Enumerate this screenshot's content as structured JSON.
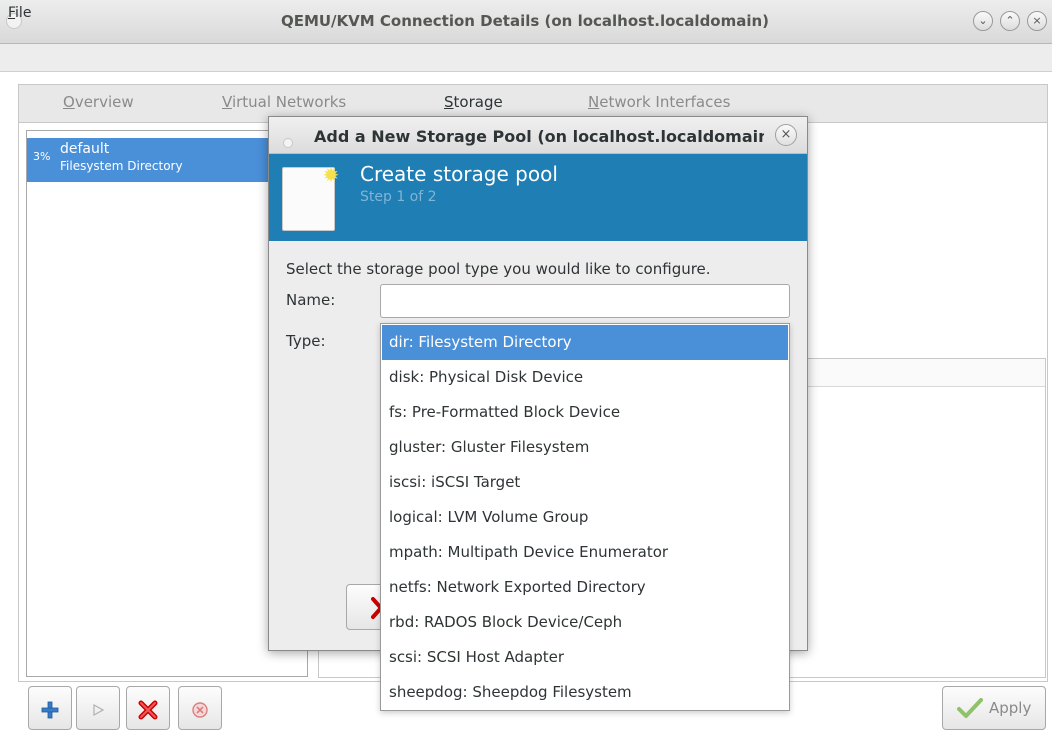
{
  "window": {
    "title": "QEMU/KVM Connection Details (on localhost.localdomain)",
    "controls": {
      "minimize": "⌄",
      "maximize": "⌃",
      "close": "×"
    }
  },
  "menubar": {
    "file": {
      "mnemonic": "F",
      "rest": "ile"
    }
  },
  "tabs": [
    {
      "mnemonic": "O",
      "rest": "verview"
    },
    {
      "mnemonic": "V",
      "rest": "irtual Networks"
    },
    {
      "mnemonic": "S",
      "rest": "torage"
    },
    {
      "mnemonic": "N",
      "rest": "etwork Interfaces"
    }
  ],
  "pools": [
    {
      "percent": "3%",
      "name": "default",
      "type": "Filesystem Directory"
    }
  ],
  "toolbar": {
    "add_icon": "plus-icon",
    "start_icon": "play-icon",
    "delete_icon": "delete-icon",
    "stop_icon": "stop-icon",
    "apply_label": "Apply",
    "apply_icon": "checkmark-icon"
  },
  "dialog": {
    "title": "Add a New Storage Pool (on localhost.localdomain)",
    "close": "×",
    "banner_title": "Create storage pool",
    "banner_step": "Step 1 of 2",
    "instruction": "Select the storage pool type you would like to configure.",
    "name_label": "Name:",
    "name_value": "",
    "type_label": "Type:",
    "type_options": [
      "dir: Filesystem Directory",
      "disk: Physical Disk Device",
      "fs: Pre-Formatted Block Device",
      "gluster: Gluster Filesystem",
      "iscsi: iSCSI Target",
      "logical: LVM Volume Group",
      "mpath: Multipath Device Enumerator",
      "netfs: Network Exported Directory",
      "rbd: RADOS Block Device/Ceph",
      "scsi: SCSI Host Adapter",
      "sheepdog: Sheepdog Filesystem"
    ],
    "selected_index": 0
  },
  "colors": {
    "accent": "#4a90d9",
    "banner": "#1f7fb5",
    "delete_red": "#cc0000"
  }
}
